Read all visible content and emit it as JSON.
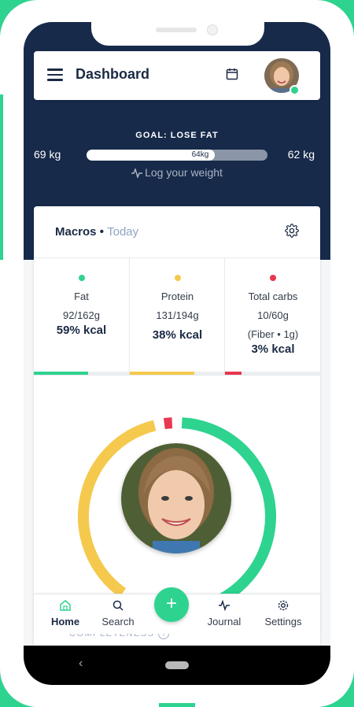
{
  "header": {
    "title": "Dashboard"
  },
  "goal": {
    "title": "GOAL: LOSE FAT",
    "start_weight": "69 kg",
    "target_weight": "62 kg",
    "current_weight": "64kg",
    "progress_fraction": 0.71,
    "log_label": "Log your weight"
  },
  "macros": {
    "title": "Macros",
    "separator": " • ",
    "period": "Today",
    "items": [
      {
        "name": "Fat",
        "amount": "92/162g",
        "pct": "59% kcal",
        "color": "#2ed38f",
        "fill_fraction": 0.57
      },
      {
        "name": "Protein",
        "amount": "131/194g",
        "pct": "38% kcal",
        "color": "#f5c94d",
        "fill_fraction": 0.68
      },
      {
        "name": "Total carbs",
        "amount": "10/60g",
        "extra": "(Fiber • 1g)",
        "pct": "3% kcal",
        "color": "#e8374f",
        "fill_fraction": 0.17
      }
    ],
    "ring": {
      "fat_pct": 59,
      "protein_pct": 38,
      "carbs_pct": 3
    }
  },
  "completeness_label": "COMPLETENESS",
  "nav": {
    "home": "Home",
    "search": "Search",
    "add": "+",
    "journal": "Journal",
    "settings": "Settings"
  },
  "system": {
    "back": "‹"
  },
  "colors": {
    "accent": "#2ed38f",
    "navy": "#172a4a",
    "fat": "#2ed38f",
    "protein": "#f5c94d",
    "carbs": "#e8374f"
  }
}
